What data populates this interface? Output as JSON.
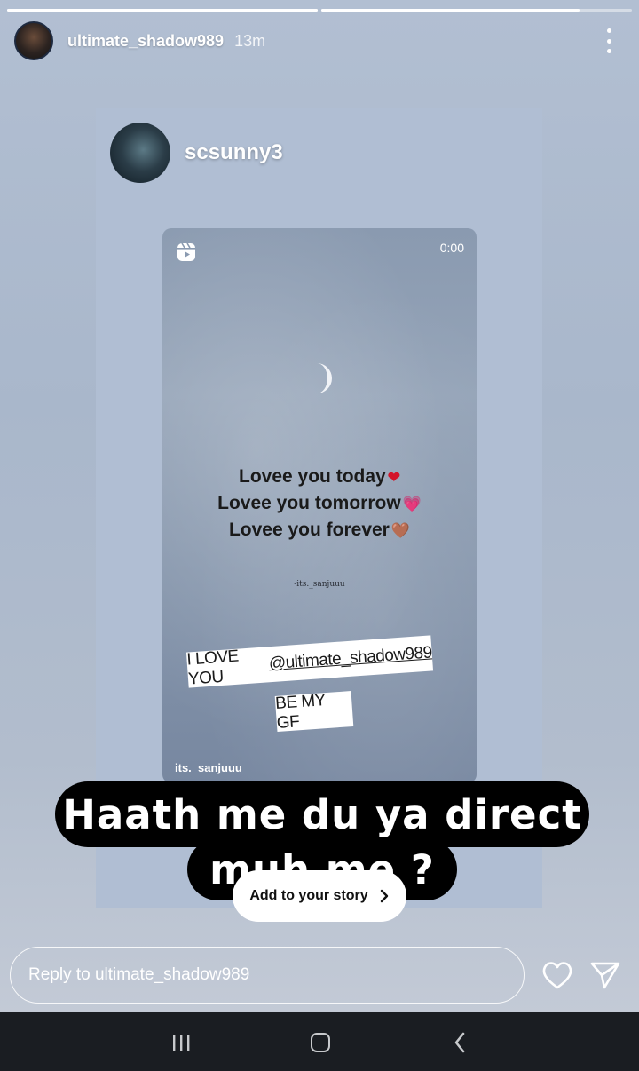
{
  "story": {
    "progress": [
      1.0,
      0.83
    ],
    "username": "ultimate_shadow989",
    "time_ago": "13m",
    "more_icon": "more-vertical-icon"
  },
  "shared_post": {
    "username": "scsunny3",
    "reel": {
      "timestamp": "0:00",
      "lyrics": [
        "Lovee you today",
        "Lovee you tomorrow",
        "Lovee you forever"
      ],
      "hearts": [
        "❤",
        "💗",
        "🤎"
      ],
      "small_credit": "-its._sanjuuu",
      "sticker_text": "I LOVE YOU",
      "sticker_mention": "@ultimate_shadow989",
      "sticker2_text": "BE MY GF",
      "handle": "its._sanjuuu"
    }
  },
  "caption": {
    "line1": "Haath me du ya direct",
    "line2": "muh me ?"
  },
  "add_story": {
    "label": "Add to your story"
  },
  "reply_bar": {
    "placeholder": "Reply to ultimate_shadow989"
  },
  "colors": {
    "background": "#b2bfd2",
    "caption_bg": "#000000",
    "navbar": "#1a1d22"
  }
}
